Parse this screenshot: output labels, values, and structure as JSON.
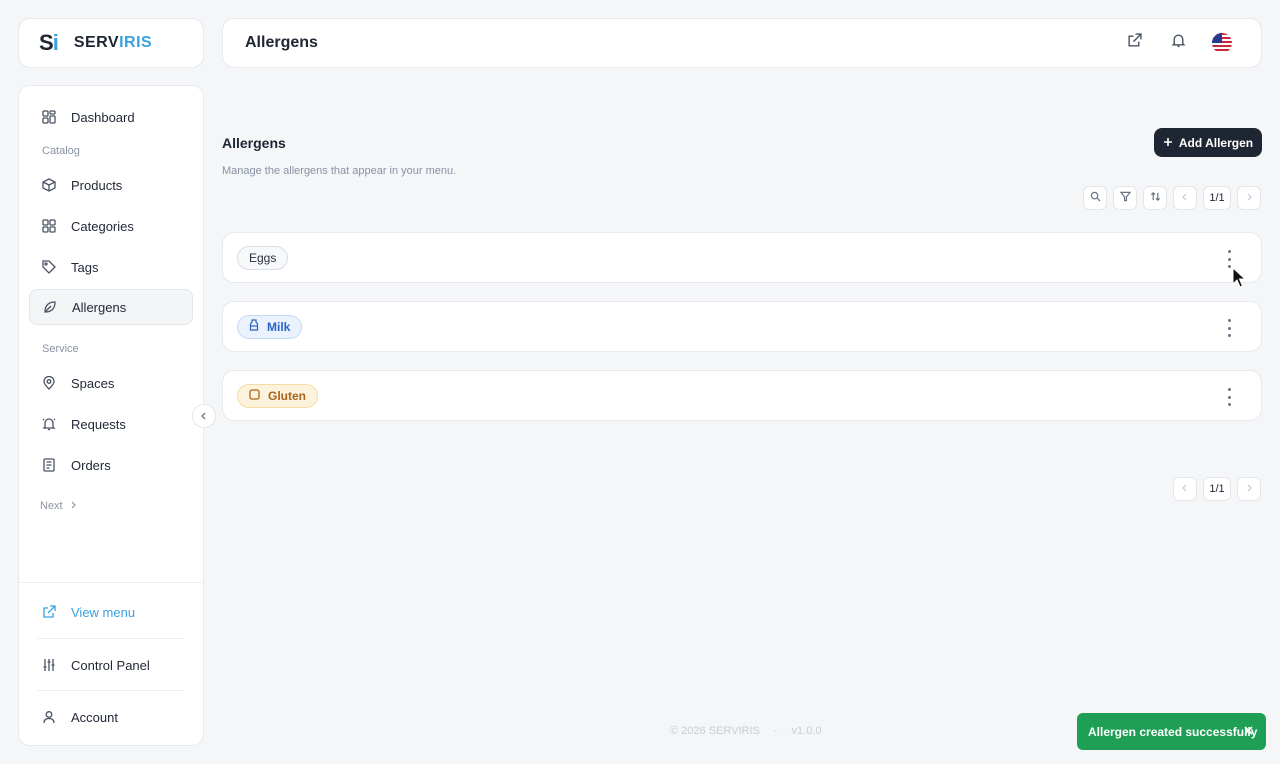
{
  "brand": {
    "mark_s": "S",
    "mark_i": "i",
    "name_a": "SERV",
    "name_b": "IRIS"
  },
  "sidebar": {
    "items": [
      {
        "label": "Dashboard",
        "icon": "dashboard-icon"
      },
      {
        "label": "Products",
        "icon": "box-icon"
      },
      {
        "label": "Categories",
        "icon": "grid-icon"
      },
      {
        "label": "Tags",
        "icon": "tag-icon"
      },
      {
        "label": "Allergens",
        "icon": "leaf-icon",
        "active": true
      },
      {
        "label": "Spaces",
        "icon": "map-pin-icon"
      },
      {
        "label": "Requests",
        "icon": "bell-ring-icon"
      },
      {
        "label": "Orders",
        "icon": "receipt-icon"
      }
    ],
    "sections": {
      "catalog": "Catalog",
      "service": "Service"
    },
    "next_label": "Next",
    "bottom": {
      "view_menu": "View menu",
      "control_panel": "Control Panel",
      "account": "Account"
    }
  },
  "header": {
    "title": "Allergens"
  },
  "main": {
    "heading": "Allergens",
    "description": "Manage the allergens that appear in your menu.",
    "add_button": "Add Allergen",
    "pager_top": "1/1",
    "pager_bottom": "1/1",
    "allergens": [
      {
        "name": "Eggs"
      },
      {
        "name": "Milk"
      },
      {
        "name": "Gluten"
      }
    ]
  },
  "footer": {
    "copyright": "© 2026 SERVIRIS",
    "separator": "·",
    "version": "v1.0.0"
  },
  "toast": {
    "message": "Allergen created successfully"
  },
  "colors": {
    "accent": "#3aa0e0",
    "primary_button": "#1e2533",
    "toast_success": "#1f9e55"
  }
}
